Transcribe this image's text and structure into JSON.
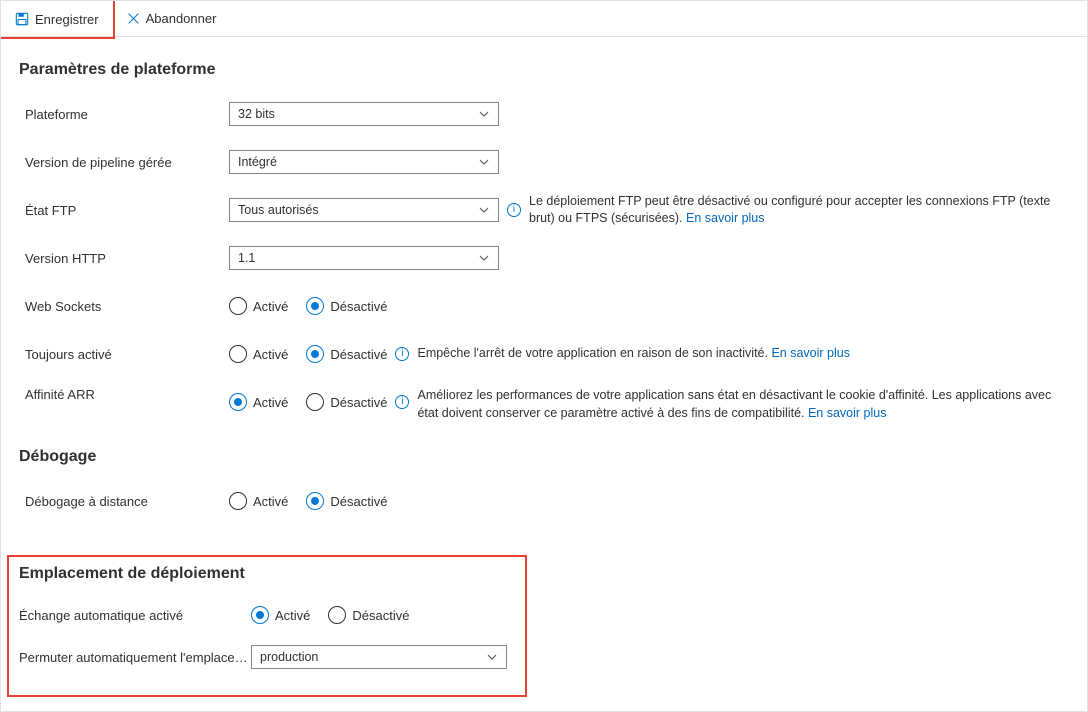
{
  "toolbar": {
    "save_label": "Enregistrer",
    "cancel_label": "Abandonner"
  },
  "sections": {
    "platform": {
      "title": "Paramètres de plateforme",
      "platform_label": "Plateforme",
      "platform_value": "32 bits",
      "pipeline_label": "Version de pipeline gérée",
      "pipeline_value": "Intégré",
      "ftp_label": "État FTP",
      "ftp_value": "Tous autorisés",
      "ftp_desc": "Le déploiement FTP peut être désactivé ou configuré pour accepter les connexions FTP (texte brut) ou FTPS (sécurisées). ",
      "http_label": "Version HTTP",
      "http_value": "1.1",
      "ws_label": "Web Sockets",
      "always_label": "Toujours activé",
      "always_desc": "Empêche l'arrêt de votre application en raison de son inactivité. ",
      "arr_label": "Affinité ARR",
      "arr_desc": "Améliorez les performances de votre application sans état en désactivant le cookie d'affinité. Les applications avec état doivent conserver ce paramètre activé à des fins de compatibilité. "
    },
    "debug": {
      "title": "Débogage",
      "remote_label": "Débogage à distance"
    },
    "slot": {
      "title": "Emplacement de déploiement",
      "autoswap_label": "Échange automatique activé",
      "autoswap_target_label": "Permuter automatiquement l'emplacement de déploiement",
      "autoswap_target_value": "production"
    }
  },
  "options": {
    "on": "Activé",
    "off": "Désactivé",
    "learn_more": "En savoir plus"
  }
}
